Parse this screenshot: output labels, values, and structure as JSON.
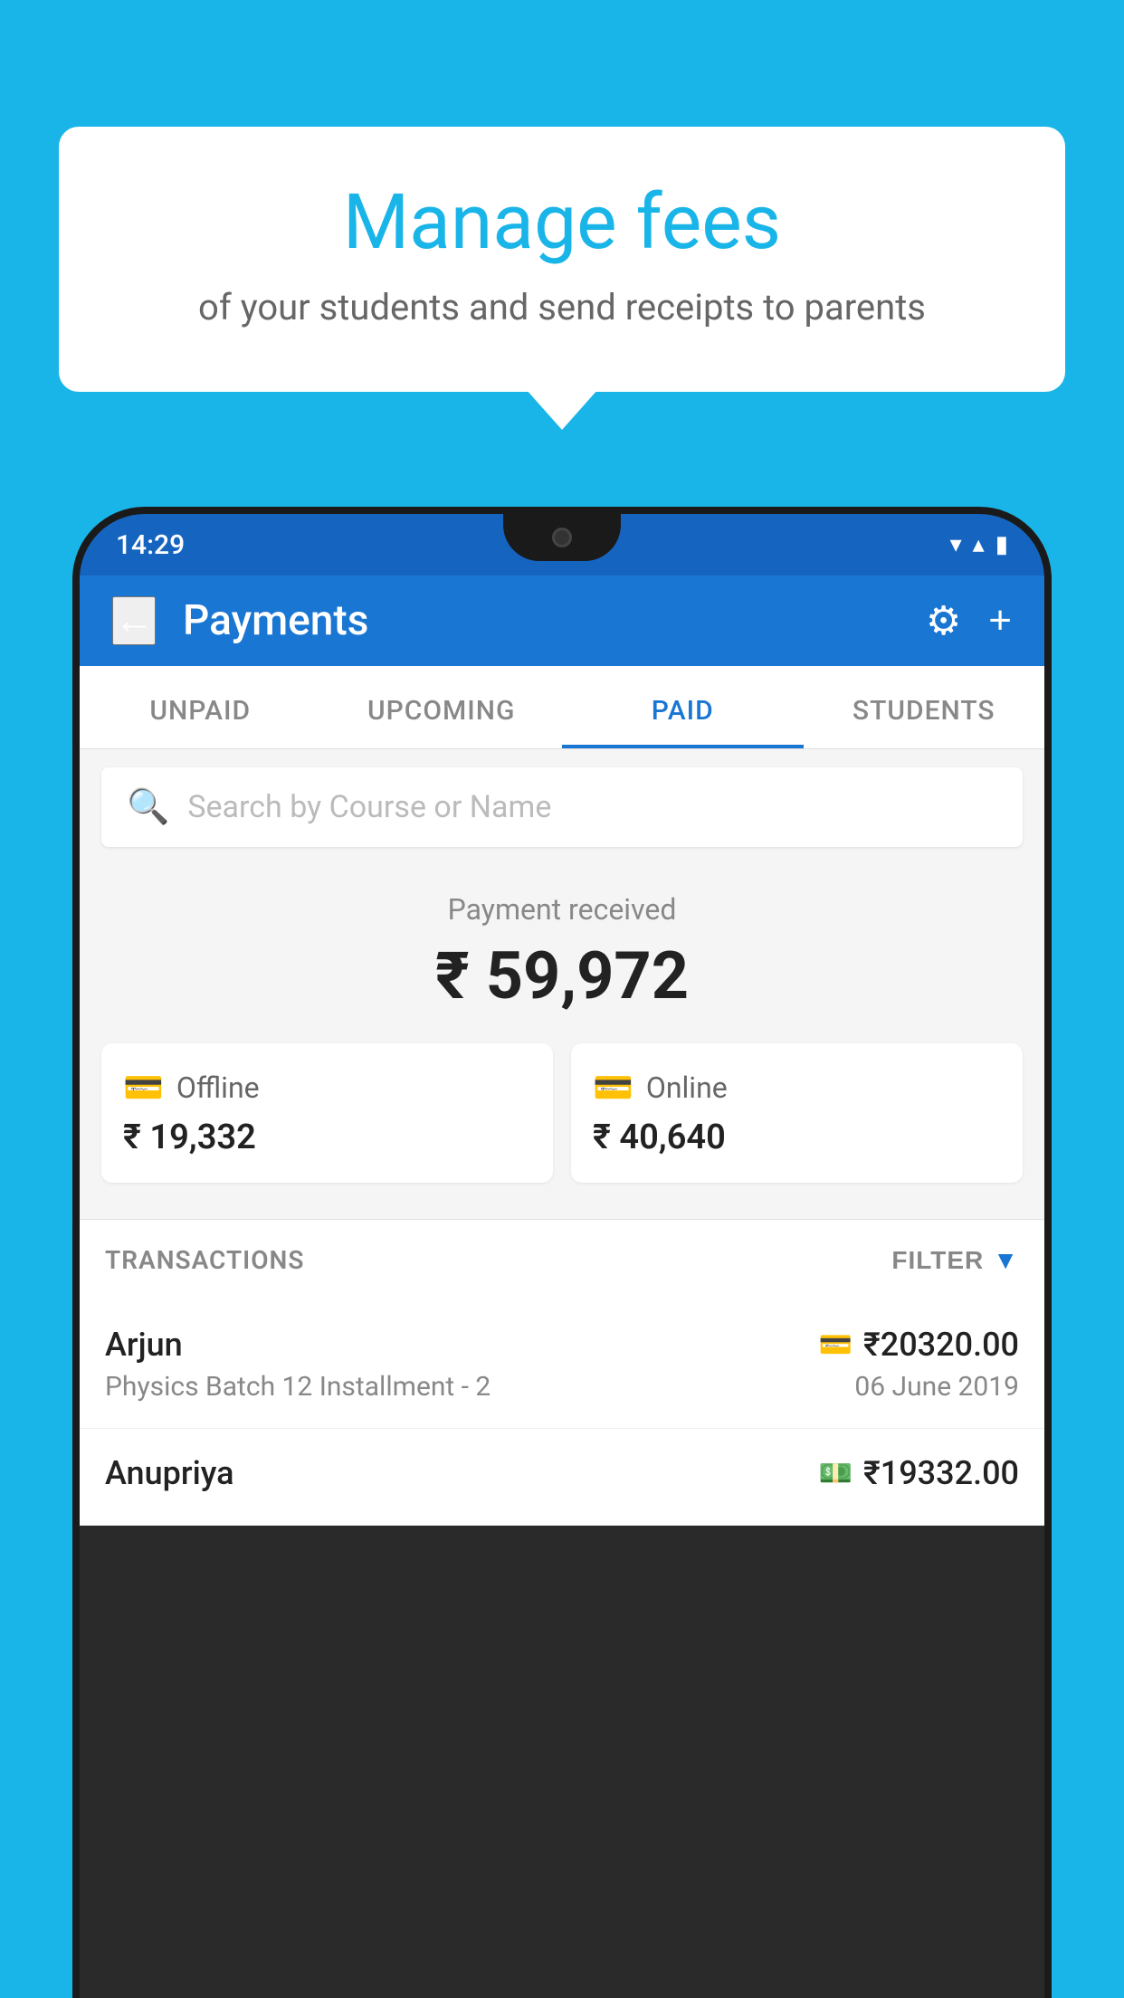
{
  "background_color": "#1ab5e8",
  "bubble": {
    "title": "Manage fees",
    "subtitle": "of your students and send receipts to parents"
  },
  "status_bar": {
    "time": "14:29",
    "wifi": "▼",
    "signal": "▲",
    "battery": "▮"
  },
  "header": {
    "title": "Payments",
    "back_label": "←",
    "gear_label": "⚙",
    "plus_label": "+"
  },
  "tabs": [
    {
      "label": "UNPAID",
      "active": false
    },
    {
      "label": "UPCOMING",
      "active": false
    },
    {
      "label": "PAID",
      "active": true
    },
    {
      "label": "STUDENTS",
      "active": false
    }
  ],
  "search": {
    "placeholder": "Search by Course or Name"
  },
  "payment_summary": {
    "label": "Payment received",
    "amount": "₹ 59,972",
    "offline": {
      "type": "Offline",
      "amount": "₹ 19,332"
    },
    "online": {
      "type": "Online",
      "amount": "₹ 40,640"
    }
  },
  "transactions_section": {
    "label": "TRANSACTIONS",
    "filter_label": "FILTER"
  },
  "transactions": [
    {
      "name": "Arjun",
      "amount": "₹20320.00",
      "course": "Physics Batch 12 Installment - 2",
      "date": "06 June 2019",
      "method": "card"
    },
    {
      "name": "Anupriya",
      "amount": "₹19332.00",
      "course": "",
      "date": "",
      "method": "cash"
    }
  ]
}
